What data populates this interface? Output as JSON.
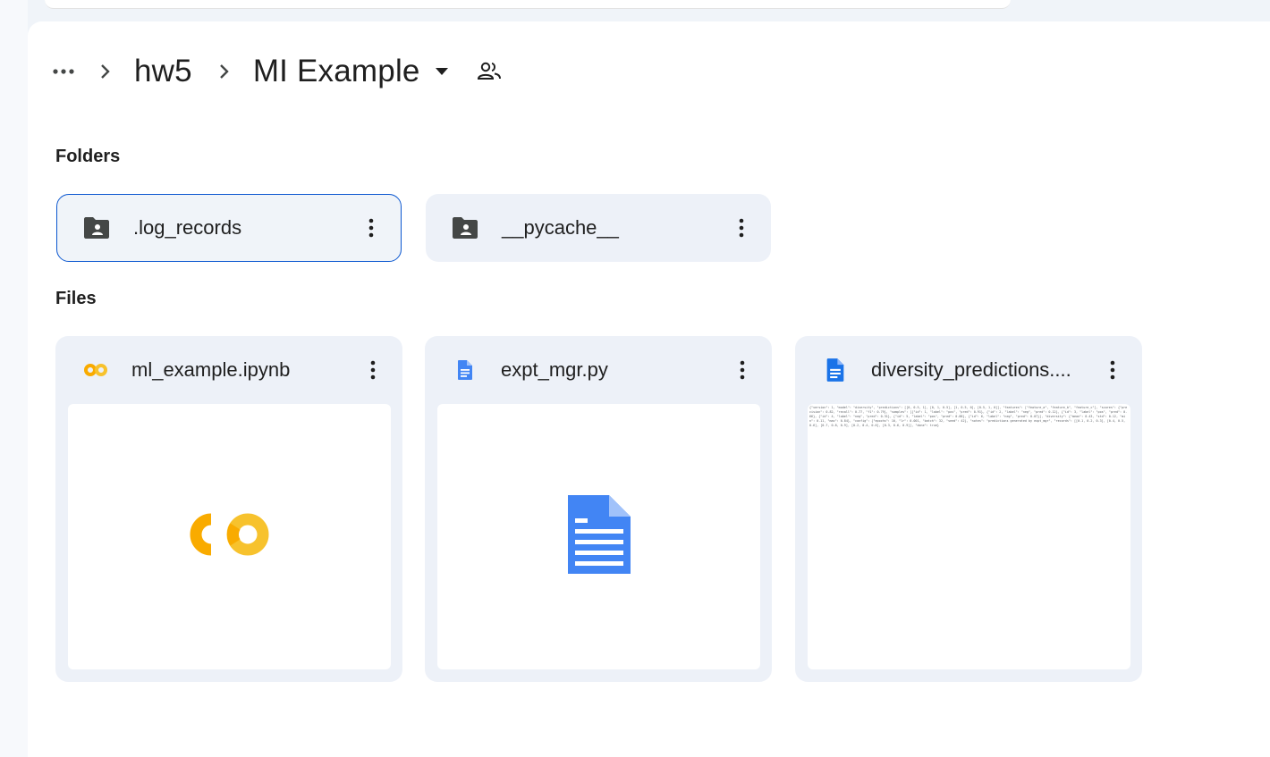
{
  "breadcrumb": {
    "more_label": "More",
    "parent": "hw5",
    "current": "MI Example"
  },
  "sections": {
    "folders_label": "Folders",
    "files_label": "Files"
  },
  "folders": [
    {
      "name": ".log_records",
      "selected": true
    },
    {
      "name": "__pycache__",
      "selected": false
    }
  ],
  "files": [
    {
      "name": "ml_example.ipynb",
      "type": "colab"
    },
    {
      "name": "expt_mgr.py",
      "type": "doc"
    },
    {
      "name": "diversity_predictions....",
      "type": "doc"
    }
  ],
  "thumbnail": {
    "preview_text": "{\"version\": 1, \"model\": \"diversity\", \"predictions\": [[0, 0.5, 1], [0, 1, 0.5], [1, 0.5, 0], [0.5, 1, 0]], \"features\": [\"feature_a\", \"feature_b\", \"feature_c\"], \"scores\": {\"precision\": 0.82, \"recall\": 0.77, \"f1\": 0.79}, \"samples\": [{\"id\": 1, \"label\": \"pos\", \"pred\": 0.91}, {\"id\": 2, \"label\": \"neg\", \"pred\": 0.12}, {\"id\": 3, \"label\": \"pos\", \"pred\": 0.66}, {\"id\": 4, \"label\": \"neg\", \"pred\": 0.31}, {\"id\": 5, \"label\": \"pos\", \"pred\": 0.88}, {\"id\": 6, \"label\": \"neg\", \"pred\": 0.07}], \"diversity\": {\"mean\": 0.43, \"std\": 0.12, \"min\": 0.11, \"max\": 0.84}, \"config\": {\"epochs\": 10, \"lr\": 0.001, \"batch\": 32, \"seed\": 42}, \"notes\": \"predictions generated by expt_mgr\", \"records\": [[0.1, 0.2, 0.3], [0.4, 0.5, 0.6], [0.7, 0.8, 0.9], [0.2, 0.4, 0.6], [0.3, 0.6, 0.9]], \"done\": true}"
  },
  "colors": {
    "accent": "#0b57d0",
    "card_bg": "#edf1f8",
    "doc_blue": "#4285f4",
    "colab_orange": "#f9ab00",
    "colab_yellow": "#f7c22d",
    "folder_icon": "#444746"
  },
  "icons": {
    "more": "more-horiz-icon",
    "separator": "chevron-right-icon",
    "dropdown": "arrow-drop-down-icon",
    "shared": "shared-people-icon",
    "folder": "shared-folder-icon",
    "kebab": "more-vert-icon",
    "colab": "colab-icon",
    "doc": "doc-icon"
  }
}
